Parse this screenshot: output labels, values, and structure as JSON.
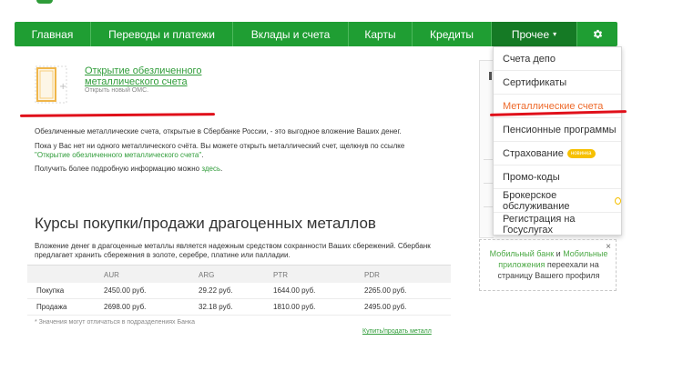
{
  "nav": {
    "items": [
      "Главная",
      "Переводы и платежи",
      "Вклады и счета",
      "Карты",
      "Кредиты",
      "Прочее"
    ],
    "active_item": "Прочее",
    "active_chevron": "▾",
    "accent_color": "#1f9e33",
    "gear_icon": "gear-icon"
  },
  "dropdown": {
    "items": [
      "Счета депо",
      "Сертификаты",
      "Металлические счета",
      "Пенсионные программы",
      "Страхование",
      "Промо-коды",
      "Брокерское обслуживание",
      "Регистрация на Госуслугах"
    ],
    "selected": "Металлические счета",
    "badge_new": "новинка"
  },
  "card": {
    "link_title": "Открытие обезличенного металлического счета",
    "subtitle": "Открыть новый ОМС."
  },
  "text": {
    "p1": "Обезличенные металлические счета, открытые в Сбербанке России, - это выгодное вложение Ваших денег.",
    "p2": "Пока у Вас нет ни одного металлического счёта. Вы можете открыть металлический счет, щелкнув по ссылке",
    "p2_link": "\"Открытие обезличенного металлического счета\"",
    "p2_end": ".",
    "p3": "Получить более подробную информацию можно",
    "p3_link": "здесь",
    "p3_end": "."
  },
  "rates": {
    "title": "Курсы покупки/продажи драгоценных металлов",
    "intro_line1": "Вложение денег в драгоценные металлы является надежным средством сохранности Ваших сбережений. Сбербанк",
    "intro_line2": "предлагает хранить сбережения в золоте, серебре, платине или палладии.",
    "columns": [
      "",
      "AUR",
      "ARG",
      "PTR",
      "PDR"
    ],
    "rows": [
      {
        "label": "Покупка",
        "values": [
          "2450.00 руб.",
          "29.22 руб.",
          "1644.00 руб.",
          "2265.00 руб."
        ]
      },
      {
        "label": "Продажа",
        "values": [
          "2698.00 руб.",
          "32.18 руб.",
          "1810.00 руб.",
          "2495.00 руб."
        ]
      }
    ],
    "footnote": "* Значения могут отличаться в подразделениях Банка",
    "buy_sell_link": "Купить/продать металл"
  },
  "tip": {
    "link1": "Мобильный банк",
    "and": " и ",
    "link2": "Мобильные приложения",
    "rest": " переехали на страницу Вашего профиля",
    "close": "×"
  },
  "colors": {
    "link": "#2f9c39",
    "selected_item": "#ee6a2b",
    "underline_mark": "#e0101a",
    "badge": "#f6c000"
  }
}
